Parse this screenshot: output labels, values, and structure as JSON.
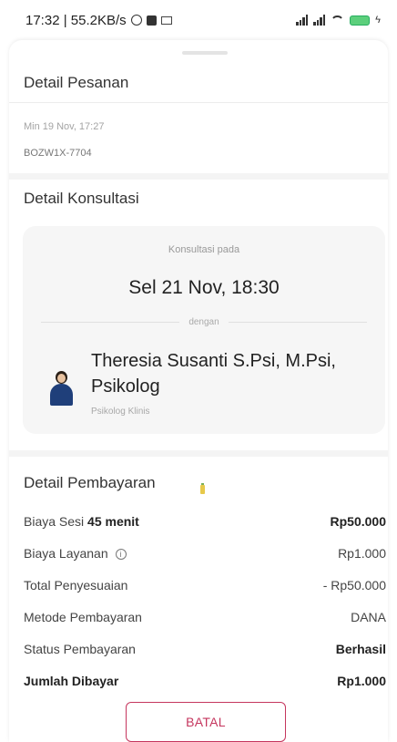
{
  "status_bar": {
    "time_speed": "17:32 | 55.2KB/s"
  },
  "order": {
    "title": "Detail Pesanan",
    "date": "Min 19 Nov, 17:27",
    "code": "BOZW1X-7704"
  },
  "consultation": {
    "title": "Detail Konsultasi",
    "on_label": "Konsultasi pada",
    "time": "Sel 21 Nov, 18:30",
    "with_label": "dengan",
    "doctor_name": "Theresia Susanti S.Psi, M.Psi, Psikolog",
    "doctor_role": "Psikolog Klinis"
  },
  "payment": {
    "title": "Detail Pembayaran",
    "session_fee_label": "Biaya Sesi",
    "session_duration": "45 menit",
    "session_fee_value": "Rp50.000",
    "service_fee_label": "Biaya Layanan",
    "service_fee_value": "Rp1.000",
    "adjustment_label": "Total Penyesuaian",
    "adjustment_value": "- Rp50.000",
    "method_label": "Metode Pembayaran",
    "method_value": "DANA",
    "status_label": "Status Pembayaran",
    "status_value": "Berhasil",
    "paid_label": "Jumlah Dibayar",
    "paid_value": "Rp1.000"
  },
  "actions": {
    "cancel_label": "BATAL"
  },
  "colors": {
    "accent": "#c5365e",
    "card_bg": "#f6f6f6"
  }
}
